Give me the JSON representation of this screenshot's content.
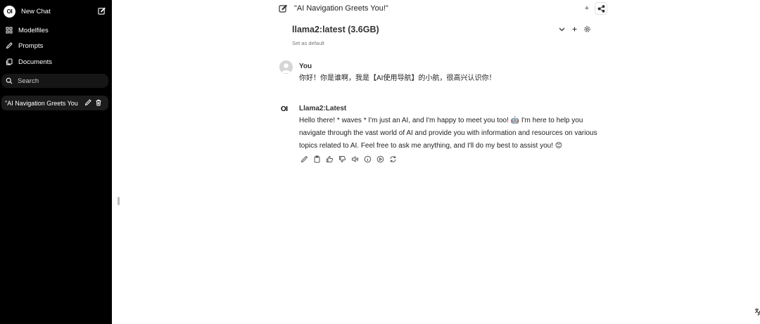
{
  "sidebar": {
    "logo_text": "OI",
    "new_chat_label": "New Chat",
    "nav": [
      {
        "label": "Modelfiles",
        "icon": "modelfiles-icon"
      },
      {
        "label": "Prompts",
        "icon": "pencil-icon"
      },
      {
        "label": "Documents",
        "icon": "documents-icon"
      }
    ],
    "search_placeholder": "Search",
    "chats": [
      {
        "title": "\"AI Navigation Greets You"
      }
    ]
  },
  "header": {
    "chat_title": "\"AI Navigation Greets You!\"",
    "plus_label": "+"
  },
  "model": {
    "name": "llama2:latest (3.6GB)",
    "set_default_label": "Set as default"
  },
  "messages": [
    {
      "author": "You",
      "text": "你好！你是谁啊，我是【AI使用导航】的小航，很高兴认识你！"
    },
    {
      "author": "Llama2:Latest",
      "avatar_text": "OI",
      "lines": [
        "Hello there! * waves * I'm just an AI, and I'm happy to meet you too! 🤖 I'm here to help you",
        "navigate through the vast world of AI and provide you with information and resources on various",
        "topics related to AI. Feel free to ask me anything, and I'll do my best to assist you! 😊"
      ]
    }
  ],
  "colors": {
    "sidebar_bg": "#000000",
    "search_bg": "#161616",
    "chat_item_bg": "#1c1c1c",
    "main_bg": "#ffffff"
  }
}
